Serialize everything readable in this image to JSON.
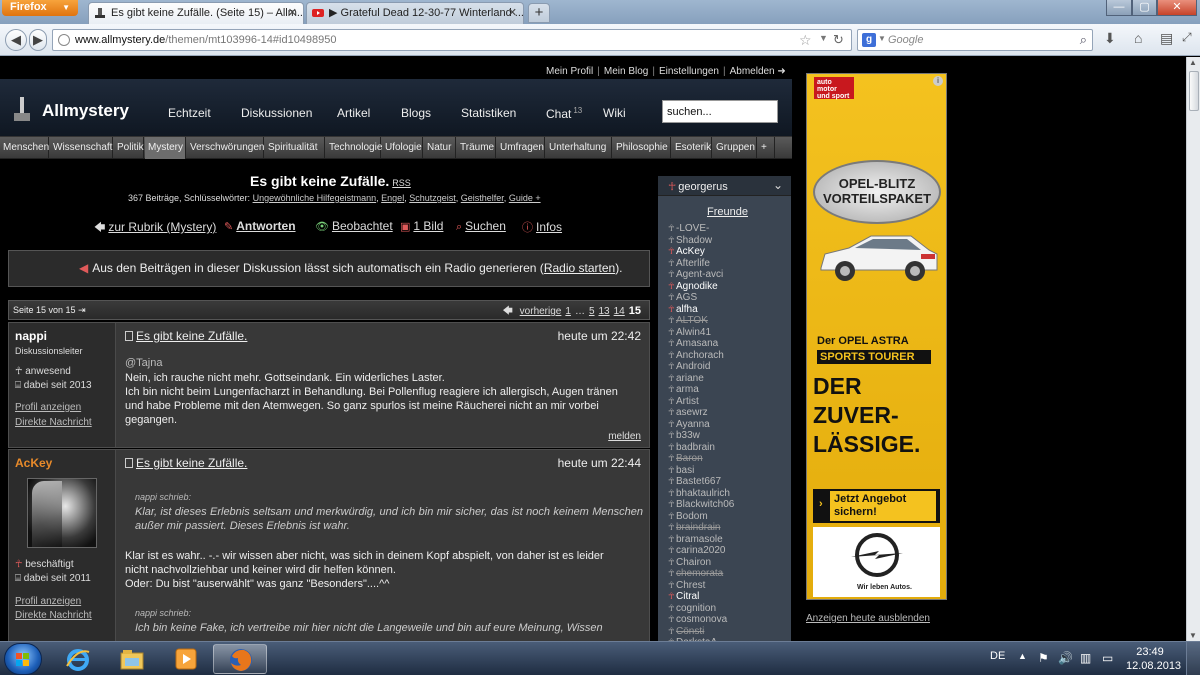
{
  "browser": {
    "menu_button": "Firefox",
    "tabs": [
      {
        "title": "Es gibt keine Zufälle. (Seite 15) – Allm...",
        "active": true
      },
      {
        "title": "▶ Grateful Dead 12-30-77 Winterland ...",
        "active": false
      }
    ],
    "new_tab": "+",
    "url_host": "www.allmystery.de",
    "url_path": "/themen/mt103996-14#id10498950",
    "search_engine": "g",
    "search_placeholder": "Google",
    "win_min": "—",
    "win_max": "▢",
    "win_close": "✕"
  },
  "site": {
    "user_links": [
      "Mein Profil",
      "Mein Blog",
      "Einstellungen",
      "Abmelden ➜"
    ],
    "logo": "Allmystery",
    "nav": [
      {
        "label": "Echtzeit"
      },
      {
        "label": "Diskussionen"
      },
      {
        "label": "Artikel"
      },
      {
        "label": "Blogs"
      },
      {
        "label": "Statistiken"
      },
      {
        "label": "Chat",
        "badge": "13"
      },
      {
        "label": "Wiki"
      }
    ],
    "search_value": "suchen...",
    "categories": [
      "Menschen",
      "Wissenschaft",
      "Politik",
      "Mystery",
      "Verschwörungen",
      "Spiritualität",
      "Technologie",
      "Ufologie",
      "Natur",
      "Träume",
      "Umfragen",
      "Unterhaltung",
      "Philosophie",
      "Esoterik",
      "Gruppen",
      "+"
    ],
    "active_category": "Mystery"
  },
  "thread": {
    "title": "Es gibt keine Zufälle.",
    "rss": "RSS",
    "meta_prefix": "367 Beiträge, Schlüsselwörter: ",
    "keywords": [
      "Ungewöhnliche Hilfegeistmann",
      "Engel",
      "Schutzgeist",
      "Geisthelfer",
      "Guide +"
    ],
    "actions": [
      {
        "icon": "🡄",
        "label": "zur Rubrik (Mystery)",
        "bold": false
      },
      {
        "icon": "✎",
        "label": "Antworten",
        "bold": true
      },
      {
        "icon": "👁",
        "label": "Beobachtet",
        "bold": false
      },
      {
        "icon": "▣",
        "label": "1 Bild",
        "bold": false
      },
      {
        "icon": "⌕",
        "label": "Suchen",
        "bold": false
      },
      {
        "icon": "ⓘ",
        "label": "Infos",
        "bold": false
      }
    ],
    "radio_text": "Aus den Beiträgen in dieser Diskussion lässt sich automatisch ein Radio generieren (",
    "radio_link": "Radio starten",
    "radio_end": ").",
    "pager_label": "Seite 15 von 15",
    "pager_prev": "vorherige",
    "pager_pages": [
      "1",
      "…",
      "5",
      "13",
      "14"
    ],
    "pager_current": "15"
  },
  "posts": [
    {
      "author": "nappi",
      "role": "Diskussionsleiter",
      "status": "anwesend",
      "since": "dabei seit 2013",
      "link_profile": "Profil anzeigen",
      "link_message": "Direkte Nachricht",
      "title": "Es gibt keine Zufälle.",
      "time": "heute um 22:42",
      "mention": "@Tajna",
      "lines": [
        "Nein, ich rauche nicht mehr. Gottseindank. Ein widerliches Laster.",
        "Ich bin nicht beim Lungenfacharzt in Behandlung. Bei Pollenflug reagiere ich allergisch, Augen tränen",
        "und habe Probleme mit den Atemwegen. So ganz spurlos ist meine Räucherei nicht an mir vorbei",
        "gegangen."
      ],
      "report": "melden"
    },
    {
      "author": "AcKey",
      "status": "beschäftigt",
      "since": "dabei seit 2011",
      "link_profile": "Profil anzeigen",
      "link_message": "Direkte Nachricht",
      "title": "Es gibt keine Zufälle.",
      "time": "heute um 22:44",
      "quote1_head": "nappi schrieb:",
      "quote1_text": "Klar, ist dieses Erlebnis seltsam und merkwürdig, und ich bin mir sicher, das ist noch keinem Menschen außer mir passiert. Dieses Erlebnis ist wahr.",
      "lines": [
        "Klar ist es wahr.. -.- wir wissen aber nicht, was sich in deinem Kopf abspielt, von daher ist es leider",
        "nicht nachvollziehbar und keiner wird dir helfen können.",
        "Oder: Du bist \"auserwählt\" was ganz \"Besonders\"....^^"
      ],
      "quote2_head": "nappi schrieb:",
      "quote2_text": "Ich bin keine Fake, ich vertreibe mir hier nicht die Langeweile und bin auf eure Meinung, Wissen"
    }
  ],
  "friends": {
    "user": "georgerus",
    "title": "Freunde",
    "list": [
      {
        "name": "-LOVE-",
        "state": "off"
      },
      {
        "name": "Shadow",
        "state": "off"
      },
      {
        "name": "AcKey",
        "state": "on"
      },
      {
        "name": "Afterlife",
        "state": "off"
      },
      {
        "name": "Agent-avci",
        "state": "off"
      },
      {
        "name": "Agnodike",
        "state": "on"
      },
      {
        "name": "AGS",
        "state": "off"
      },
      {
        "name": "alfha",
        "state": "on"
      },
      {
        "name": "ALTOK",
        "state": "strike"
      },
      {
        "name": "Alwin41",
        "state": "off"
      },
      {
        "name": "Amasana",
        "state": "off"
      },
      {
        "name": "Anchorach",
        "state": "off"
      },
      {
        "name": "Android",
        "state": "off"
      },
      {
        "name": "ariane",
        "state": "off"
      },
      {
        "name": "arma",
        "state": "off"
      },
      {
        "name": "Artist",
        "state": "off"
      },
      {
        "name": "asewrz",
        "state": "off"
      },
      {
        "name": "Ayanna",
        "state": "off"
      },
      {
        "name": "b33w",
        "state": "off"
      },
      {
        "name": "badbrain",
        "state": "off"
      },
      {
        "name": "Baron",
        "state": "strike"
      },
      {
        "name": "basi",
        "state": "off"
      },
      {
        "name": "Bastet667",
        "state": "off"
      },
      {
        "name": "bhaktaulrich",
        "state": "off"
      },
      {
        "name": "Blackwitch06",
        "state": "off"
      },
      {
        "name": "Bodom",
        "state": "off"
      },
      {
        "name": "braindrain",
        "state": "strike"
      },
      {
        "name": "bramasole",
        "state": "off"
      },
      {
        "name": "carina2020",
        "state": "off"
      },
      {
        "name": "Chairon",
        "state": "off"
      },
      {
        "name": "chemorata",
        "state": "strike"
      },
      {
        "name": "Chrest",
        "state": "off"
      },
      {
        "name": "Citral",
        "state": "on"
      },
      {
        "name": "cognition",
        "state": "off"
      },
      {
        "name": "cosmonova",
        "state": "off"
      },
      {
        "name": "Cönsti",
        "state": "strike"
      },
      {
        "name": "DarkstaA",
        "state": "off"
      }
    ]
  },
  "ad": {
    "info": "i",
    "brand": "auto motor und sport",
    "badge_line1": "OPEL-BLITZ",
    "badge_line2": "VORTEILSPAKET",
    "model": "Der OPEL ASTRA",
    "model_variant": "SPORTS TOURER",
    "headline": [
      "DER",
      "ZUVER-",
      "LÄSSIGE."
    ],
    "cta_arrow": "›",
    "cta": "Jetzt Angebot sichern!",
    "slogan": "Wir leben Autos.",
    "hide_link": "Anzeigen heute ausblenden"
  },
  "taskbar": {
    "lang": "DE",
    "time": "23:49",
    "date": "12.08.2013"
  },
  "colors": {
    "accent_orange": "#e88a2a",
    "ad_yellow": "#f4c21f",
    "online_red": "#e05a5a"
  }
}
